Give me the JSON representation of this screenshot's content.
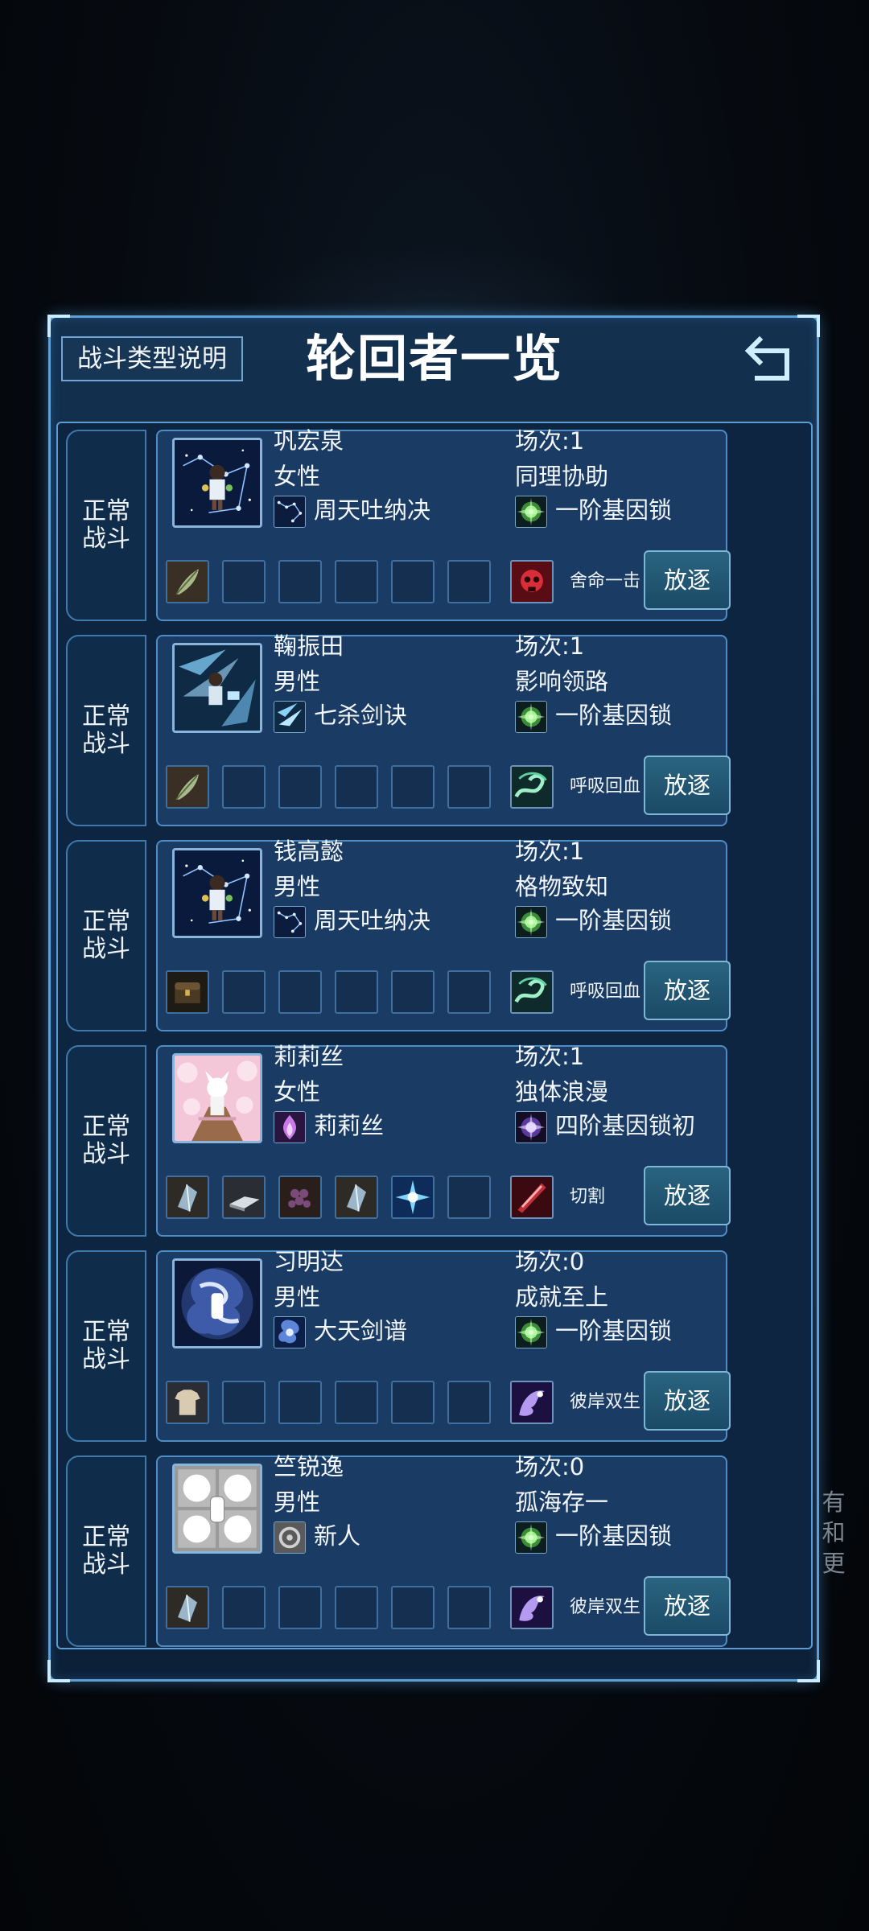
{
  "header": {
    "help_button": "战斗类型说明",
    "title": "轮回者一览"
  },
  "entries": [
    {
      "battle_type": "正常战斗",
      "name": "巩宏泉",
      "gender": "女性",
      "skill": "周天吐纳决",
      "sessions": "场次:1",
      "trait": "同理协助",
      "gene_lock": "一阶基因锁",
      "talent": "舍命一击",
      "exile": "放逐",
      "portrait": "starfield-portrait",
      "skill_icon": "constellation-icon",
      "gene_icon": "green-orb-icon",
      "talent_icon": "red-skull-icon",
      "equipment": [
        "feather-icon",
        "",
        "",
        "",
        "",
        ""
      ]
    },
    {
      "battle_type": "正常战斗",
      "name": "鞠振田",
      "gender": "男性",
      "skill": "七杀剑诀",
      "sessions": "场次:1",
      "trait": "影响领路",
      "gene_lock": "一阶基因锁",
      "talent": "呼吸回血",
      "exile": "放逐",
      "portrait": "sword-slash-portrait",
      "skill_icon": "sword-slash-icon",
      "gene_icon": "green-orb-icon",
      "talent_icon": "green-swirl-icon",
      "equipment": [
        "feather-icon",
        "",
        "",
        "",
        "",
        ""
      ]
    },
    {
      "battle_type": "正常战斗",
      "name": "钱高懿",
      "gender": "男性",
      "skill": "周天吐纳决",
      "sessions": "场次:1",
      "trait": "格物致知",
      "gene_lock": "一阶基因锁",
      "talent": "呼吸回血",
      "exile": "放逐",
      "portrait": "starfield-portrait",
      "skill_icon": "constellation-icon",
      "gene_icon": "green-orb-icon",
      "talent_icon": "green-swirl-icon",
      "equipment": [
        "chest-icon",
        "",
        "",
        "",
        "",
        ""
      ]
    },
    {
      "battle_type": "正常战斗",
      "name": "莉莉丝",
      "gender": "女性",
      "skill": "莉莉丝",
      "sessions": "场次:1",
      "trait": "独体浪漫",
      "gene_lock": "四阶基因锁初",
      "talent": "切割",
      "exile": "放逐",
      "portrait": "pink-blossom-portrait",
      "skill_icon": "purple-flame-icon",
      "gene_icon": "purple-orb-icon",
      "talent_icon": "red-blade-icon",
      "equipment": [
        "crystal-icon",
        "book-icon",
        "berries-icon",
        "crystal-icon",
        "blue-burst-icon",
        ""
      ]
    },
    {
      "battle_type": "正常战斗",
      "name": "习明达",
      "gender": "男性",
      "skill": "大天剑谱",
      "sessions": "场次:0",
      "trait": "成就至上",
      "gene_lock": "一阶基因锁",
      "talent": "彼岸双生",
      "exile": "放逐",
      "portrait": "vortex-portrait",
      "skill_icon": "blue-swirl-icon",
      "gene_icon": "green-orb-icon",
      "talent_icon": "purple-spirit-icon",
      "equipment": [
        "shirt-icon",
        "",
        "",
        "",
        "",
        ""
      ]
    },
    {
      "battle_type": "正常战斗",
      "name": "竺锐逸",
      "gender": "男性",
      "skill": "新人",
      "sessions": "场次:0",
      "trait": "孤海存一",
      "gene_lock": "一阶基因锁",
      "talent": "彼岸双生",
      "exile": "放逐",
      "portrait": "gray-tile-portrait",
      "skill_icon": "gray-ring-icon",
      "gene_icon": "green-orb-icon",
      "talent_icon": "purple-spirit-icon",
      "equipment": [
        "crystal-icon",
        "",
        "",
        "",
        "",
        ""
      ]
    }
  ],
  "side_hint": "有和更",
  "colors": {
    "panel_border": "#5e9fd6",
    "card_bg": "#1a3b63",
    "exile_button": "#1f5572"
  }
}
